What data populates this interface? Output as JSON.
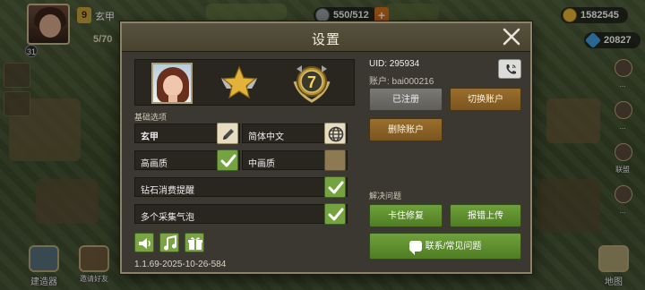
{
  "hud": {
    "player_name": "玄甲",
    "player_level": "31",
    "name_badge": "9",
    "troop_count": "5/70",
    "resource_storage": "550/512",
    "coins": "1582545",
    "gems": "20827",
    "side_labels": [
      "...",
      "...",
      "联盟",
      "...",
      "...",
      "..."
    ],
    "bottom_left_label": "建造器",
    "bottom_left2_label": "邀请好友",
    "bottom_right_label": "地图"
  },
  "dialog": {
    "title": "设置",
    "close_icon": "close-icon",
    "uid": "UID: 295934",
    "account": "账户: bai000216",
    "basic_options_label": "基础选项",
    "name_value": "玄甲",
    "language_value": "简体中文",
    "quality_high": "高画质",
    "quality_high_checked": true,
    "quality_mid": "中画质",
    "quality_mid_checked": false,
    "diamond_reminder": "钻石消费提醒",
    "diamond_reminder_checked": true,
    "multi_bubble": "多个采集气泡",
    "multi_bubble_checked": true,
    "version": "1.1.69-2025-10-26-584",
    "registered_btn": "已注册",
    "switch_account_btn": "切换账户",
    "delete_account_btn": "删除账户",
    "solve_problems_label": "解决问题",
    "stuck_fix_btn": "卡住修复",
    "report_bug_btn": "报错上传",
    "contact_btn": "联系/常见问题",
    "level_badge_number": "7"
  },
  "colors": {
    "dialog_bg": "#3b3832",
    "green_btn": "#6fa13a",
    "brown_btn": "#9a6f2c",
    "gray_btn": "#7c7a74"
  }
}
